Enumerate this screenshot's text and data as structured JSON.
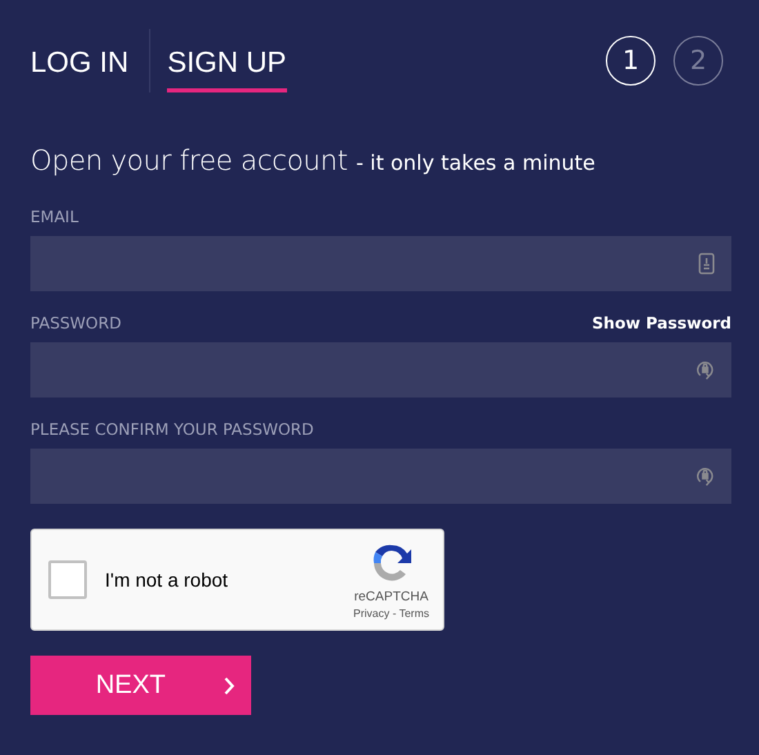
{
  "tabs": [
    {
      "label": "LOG IN",
      "selected": false
    },
    {
      "label": "SIGN UP",
      "selected": true
    }
  ],
  "steps": [
    {
      "label": "1",
      "selected": true
    },
    {
      "label": "2",
      "selected": false
    }
  ],
  "heading": {
    "title": "Open your free account",
    "note": "- it only takes a minute"
  },
  "fields": [
    {
      "label": "EMAIL",
      "kind": "email"
    },
    {
      "label": "PASSWORD",
      "kind": "password",
      "action": "Show Password"
    },
    {
      "label": "PLEASE CONFIRM YOUR PASSWORD",
      "kind": "password"
    }
  ],
  "captcha": {
    "label": "I'm not a robot",
    "checked": false,
    "brand": "reCAPTCHA",
    "links": "Privacy - Terms"
  },
  "next_button": {
    "label": "NEXT"
  }
}
